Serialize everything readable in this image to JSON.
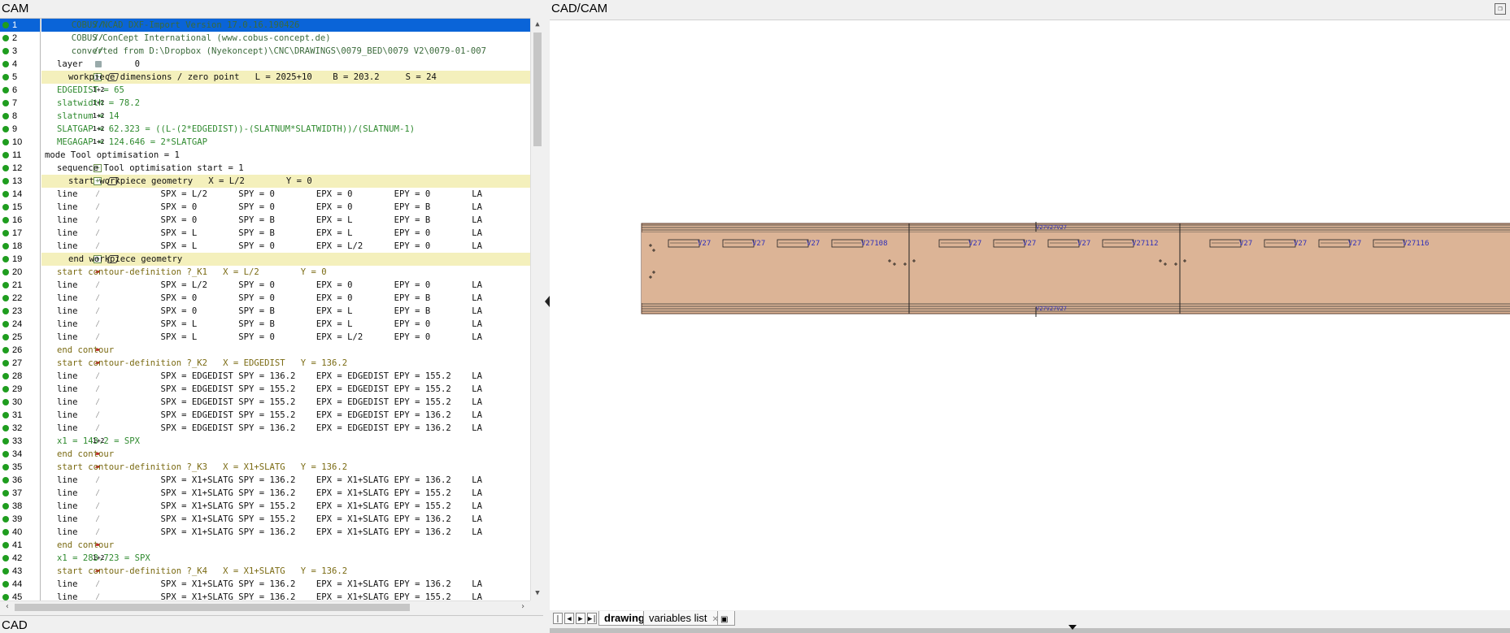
{
  "panes": {
    "cam_title": "CAM",
    "cad_title": "CAD",
    "cadcam_title": "CAD/CAM"
  },
  "colors": {
    "selection": "#0a64d8",
    "highlight_row": "#f4f0bc",
    "panel_fill": "#dcb496",
    "panel_stroke": "#5a3a2a",
    "label_blue": "#2e2eb8"
  },
  "code_lines": [
    {
      "n": "1",
      "icon": "comment",
      "style": "sel",
      "text": "  COBUS NCAD DXF-Import Version 17.0.16.190426"
    },
    {
      "n": "2",
      "icon": "comment",
      "style": "",
      "text": "  COBUS ConCept International (www.cobus-concept.de)"
    },
    {
      "n": "3",
      "icon": "comment",
      "style": "",
      "text": "  converted from D:\\Dropbox (Nyekoncept)\\CNC\\DRAWINGS\\0079_BED\\0079 V2\\0079-01-007"
    },
    {
      "n": "4",
      "icon": "layer",
      "style": "",
      "text": "layer          0"
    },
    {
      "n": "5",
      "icon": "plus-group",
      "style": "hl",
      "text": "workpiece dimensions / zero point   L = 2025+10    B = 203.2     S = 24"
    },
    {
      "n": "6",
      "icon": "var",
      "style": "",
      "text": "EDGEDIST = 65"
    },
    {
      "n": "7",
      "icon": "var",
      "style": "",
      "text": "slatwidth = 78.2"
    },
    {
      "n": "8",
      "icon": "var",
      "style": "",
      "text": "slatnum = 14"
    },
    {
      "n": "9",
      "icon": "var",
      "style": "",
      "text": "SLATGAP = 62.323 = ((L-(2*EDGEDIST))-(SLATNUM*SLATWIDTH))/(SLATNUM-1)"
    },
    {
      "n": "10",
      "icon": "var",
      "style": "",
      "text": "MEGAGAP = 124.646 = 2*SLATGAP"
    },
    {
      "n": "11",
      "icon": "none",
      "style": "",
      "text": "mode Tool optimisation = 1"
    },
    {
      "n": "12",
      "icon": "plus",
      "style": "",
      "text": "sequence Tool optimisation start = 1"
    },
    {
      "n": "13",
      "icon": "plus-group",
      "style": "hl",
      "text": "start workpiece geometry   X = L/2        Y = 0"
    },
    {
      "n": "14",
      "icon": "line",
      "style": "",
      "text": "line                SPX = L/2      SPY = 0        EPX = 0        EPY = 0        LA"
    },
    {
      "n": "15",
      "icon": "line",
      "style": "",
      "text": "line                SPX = 0        SPY = 0        EPX = 0        EPY = B        LA"
    },
    {
      "n": "16",
      "icon": "line",
      "style": "",
      "text": "line                SPX = 0        SPY = B        EPX = L        EPY = B        LA"
    },
    {
      "n": "17",
      "icon": "line",
      "style": "",
      "text": "line                SPX = L        SPY = B        EPX = L        EPY = 0        LA"
    },
    {
      "n": "18",
      "icon": "line",
      "style": "",
      "text": "line                SPX = L        SPY = 0        EPX = L/2      EPY = 0        LA"
    },
    {
      "n": "19",
      "icon": "plus-group",
      "style": "hl",
      "text": "end workpiece geometry"
    },
    {
      "n": "20",
      "icon": "contour",
      "style": "",
      "text": "start contour-definition ?_K1   X = L/2        Y = 0"
    },
    {
      "n": "21",
      "icon": "line",
      "style": "",
      "text": "line                SPX = L/2      SPY = 0        EPX = 0        EPY = 0        LA"
    },
    {
      "n": "22",
      "icon": "line",
      "style": "",
      "text": "line                SPX = 0        SPY = 0        EPX = 0        EPY = B        LA"
    },
    {
      "n": "23",
      "icon": "line",
      "style": "",
      "text": "line                SPX = 0        SPY = B        EPX = L        EPY = B        LA"
    },
    {
      "n": "24",
      "icon": "line",
      "style": "",
      "text": "line                SPX = L        SPY = B        EPX = L        EPY = 0        LA"
    },
    {
      "n": "25",
      "icon": "line",
      "style": "",
      "text": "line                SPX = L        SPY = 0        EPX = L/2      EPY = 0        LA"
    },
    {
      "n": "26",
      "icon": "contour",
      "style": "",
      "text": "end contour"
    },
    {
      "n": "27",
      "icon": "contour",
      "style": "",
      "text": "start contour-definition ?_K2   X = EDGEDIST   Y = 136.2"
    },
    {
      "n": "28",
      "icon": "line",
      "style": "",
      "text": "line                SPX = EDGEDIST SPY = 136.2    EPX = EDGEDIST EPY = 155.2    LA"
    },
    {
      "n": "29",
      "icon": "line",
      "style": "",
      "text": "line                SPX = EDGEDIST SPY = 155.2    EPX = EDGEDIST EPY = 155.2    LA"
    },
    {
      "n": "30",
      "icon": "line",
      "style": "",
      "text": "line                SPX = EDGEDIST SPY = 155.2    EPX = EDGEDIST EPY = 155.2    LA"
    },
    {
      "n": "31",
      "icon": "line",
      "style": "",
      "text": "line                SPX = EDGEDIST SPY = 155.2    EPX = EDGEDIST EPY = 136.2    LA"
    },
    {
      "n": "32",
      "icon": "line",
      "style": "",
      "text": "line                SPX = EDGEDIST SPY = 136.2    EPX = EDGEDIST EPY = 136.2    LA"
    },
    {
      "n": "33",
      "icon": "var",
      "style": "",
      "text": "x1 = 143.2 = SPX"
    },
    {
      "n": "34",
      "icon": "contour",
      "style": "",
      "text": "end contour"
    },
    {
      "n": "35",
      "icon": "contour",
      "style": "",
      "text": "start contour-definition ?_K3   X = X1+SLATG   Y = 136.2"
    },
    {
      "n": "36",
      "icon": "line",
      "style": "",
      "text": "line                SPX = X1+SLATG SPY = 136.2    EPX = X1+SLATG EPY = 136.2    LA"
    },
    {
      "n": "37",
      "icon": "line",
      "style": "",
      "text": "line                SPX = X1+SLATG SPY = 136.2    EPX = X1+SLATG EPY = 155.2    LA"
    },
    {
      "n": "38",
      "icon": "line",
      "style": "",
      "text": "line                SPX = X1+SLATG SPY = 155.2    EPX = X1+SLATG EPY = 155.2    LA"
    },
    {
      "n": "39",
      "icon": "line",
      "style": "",
      "text": "line                SPX = X1+SLATG SPY = 155.2    EPX = X1+SLATG EPY = 136.2    LA"
    },
    {
      "n": "40",
      "icon": "line",
      "style": "",
      "text": "line                SPX = X1+SLATG SPY = 136.2    EPX = X1+SLATG EPY = 136.2    LA"
    },
    {
      "n": "41",
      "icon": "contour",
      "style": "",
      "text": "end contour"
    },
    {
      "n": "42",
      "icon": "var",
      "style": "",
      "text": "x1 = 283.723 = SPX"
    },
    {
      "n": "43",
      "icon": "contour",
      "style": "",
      "text": "start contour-definition ?_K4   X = X1+SLATG   Y = 136.2"
    },
    {
      "n": "44",
      "icon": "line",
      "style": "",
      "text": "line                SPX = X1+SLATG SPY = 136.2    EPX = X1+SLATG EPY = 136.2    LA"
    },
    {
      "n": "45",
      "icon": "line",
      "style": "",
      "text": "line                SPX = X1+SLATG SPY = 136.2    EPX = X1+SLATG EPY = 155.2    LA"
    }
  ],
  "drawing": {
    "slot_labels": [
      "V27108",
      "V27112",
      "V27116"
    ],
    "slot_prefix": "V27",
    "top_label": "V27",
    "bottom_label": "V27"
  },
  "tabs": {
    "drawing": "drawing",
    "variables": "variables list"
  },
  "nav": {
    "first": "|◀",
    "prev": "◀",
    "next": "▶",
    "last": "▶|"
  }
}
